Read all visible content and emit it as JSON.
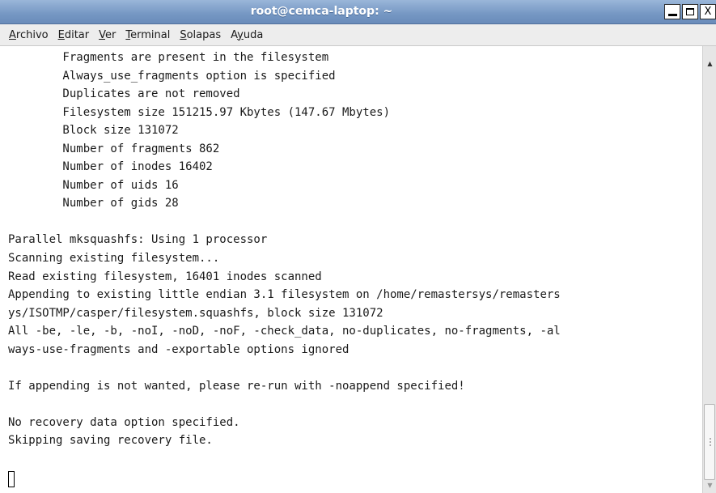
{
  "window": {
    "title": "root@cemca-laptop: ~",
    "controls": {
      "minimize": "minimize-icon",
      "maximize": "maximize-icon",
      "close": "close-icon",
      "close_glyph": "X"
    }
  },
  "menu": [
    {
      "mnemonic": "A",
      "rest": "rchivo"
    },
    {
      "mnemonic": "E",
      "rest": "ditar"
    },
    {
      "mnemonic": "V",
      "rest": "er"
    },
    {
      "mnemonic": "T",
      "rest": "erminal"
    },
    {
      "mnemonic": "S",
      "rest": "olapas"
    },
    {
      "pre": "A",
      "mnemonic": "y",
      "rest": "uda"
    }
  ],
  "terminal": {
    "lines": [
      "        Fragments are present in the filesystem",
      "        Always_use_fragments option is specified",
      "        Duplicates are not removed",
      "        Filesystem size 151215.97 Kbytes (147.67 Mbytes)",
      "        Block size 131072",
      "        Number of fragments 862",
      "        Number of inodes 16402",
      "        Number of uids 16",
      "        Number of gids 28",
      "",
      "Parallel mksquashfs: Using 1 processor",
      "Scanning existing filesystem...",
      "Read existing filesystem, 16401 inodes scanned",
      "Appending to existing little endian 3.1 filesystem on /home/remastersys/remasters",
      "ys/ISOTMP/casper/filesystem.squashfs, block size 131072",
      "All -be, -le, -b, -noI, -noD, -noF, -check_data, no-duplicates, no-fragments, -al",
      "ways-use-fragments and -exportable options ignored",
      "",
      "If appending is not wanted, please re-run with -noappend specified!",
      "",
      "No recovery data option specified.",
      "Skipping saving recovery file.",
      ""
    ]
  },
  "scrollbar": {
    "up_icon": "scroll-up-arrow-icon",
    "down_icon": "scroll-down-arrow-icon",
    "position": 1.0
  },
  "colors": {
    "titlebar": "#7597c3",
    "menubar": "#ededed",
    "terminal_bg": "#ffffff",
    "text": "#1a1a1a"
  }
}
